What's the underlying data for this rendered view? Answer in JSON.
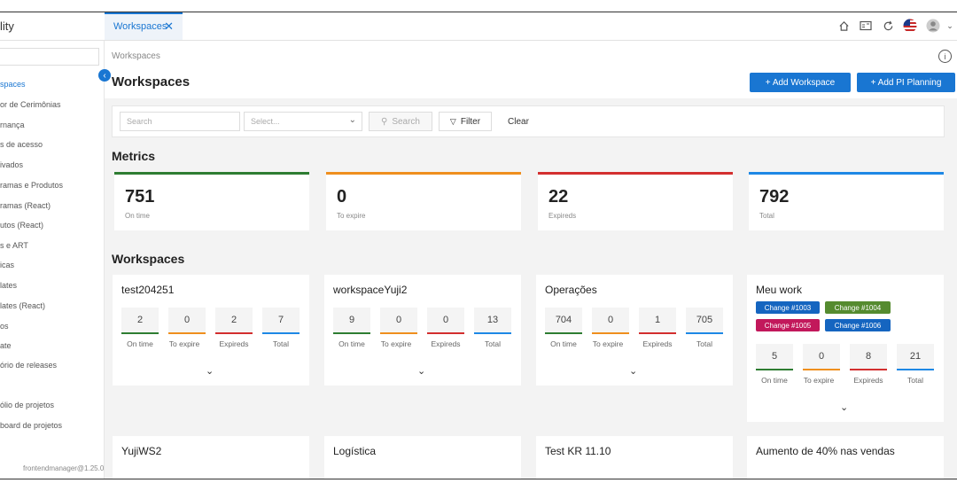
{
  "header": {
    "app_name": "lity",
    "tab_label": "Workspaces",
    "tab_close": "✕",
    "icons": [
      "home-icon",
      "id-card-icon",
      "refresh-icon",
      "us-flag-icon",
      "user-avatar-icon"
    ]
  },
  "sidebar": {
    "items": [
      "spaces",
      "or de Cerimônias",
      "rnança",
      "s de acesso",
      "ivados",
      "ramas e Produtos",
      "ramas (React)",
      "utos (React)",
      "s e ART",
      "icas",
      "lates",
      "lates (React)",
      "os",
      "ate",
      "ório de releases",
      "",
      "ólio de projetos",
      "board de projetos"
    ],
    "active_index": 0,
    "version": "frontendmanager@1.25.0"
  },
  "page": {
    "breadcrumb": "Workspaces",
    "title": "Workspaces",
    "add_workspace": "+ Add Workspace",
    "add_pi_planning": "+ Add PI Planning"
  },
  "filters": {
    "search_placeholder": "Search",
    "select_placeholder": "Select...",
    "search_button": "Search",
    "filter_button": "Filter",
    "clear_button": "Clear"
  },
  "metrics": {
    "title": "Metrics",
    "cards": [
      {
        "value": "751",
        "label": "On time",
        "color": "#2e7d32"
      },
      {
        "value": "0",
        "label": "To expire",
        "color": "#ef8f1e"
      },
      {
        "value": "22",
        "label": "Expireds",
        "color": "#d32f2f"
      },
      {
        "value": "792",
        "label": "Total",
        "color": "#1e88e5"
      }
    ]
  },
  "workspaces": {
    "title": "Workspaces",
    "stat_labels": [
      "On time",
      "To expire",
      "Expireds",
      "Total"
    ],
    "stat_colors": [
      "#2e7d32",
      "#ef8f1e",
      "#d32f2f",
      "#1e88e5"
    ],
    "cards": [
      {
        "name": "test204251",
        "stats": [
          "2",
          "0",
          "2",
          "7"
        ],
        "tags": []
      },
      {
        "name": "workspaceYuji2",
        "stats": [
          "9",
          "0",
          "0",
          "13"
        ],
        "tags": []
      },
      {
        "name": "Operações",
        "stats": [
          "704",
          "0",
          "1",
          "705"
        ],
        "tags": []
      },
      {
        "name": "Meu work",
        "stats": [
          "5",
          "0",
          "8",
          "21"
        ],
        "tags": [
          {
            "label": "Change #1003",
            "color": "#1565c0"
          },
          {
            "label": "Change #1004",
            "color": "#558b2f"
          },
          {
            "label": "Change #1005",
            "color": "#c2185b"
          },
          {
            "label": "Change #1006",
            "color": "#1565c0"
          }
        ]
      }
    ],
    "partial_cards": [
      "YujiWS2",
      "Logística",
      "Test KR 11.10",
      "Aumento de 40% nas vendas"
    ]
  }
}
